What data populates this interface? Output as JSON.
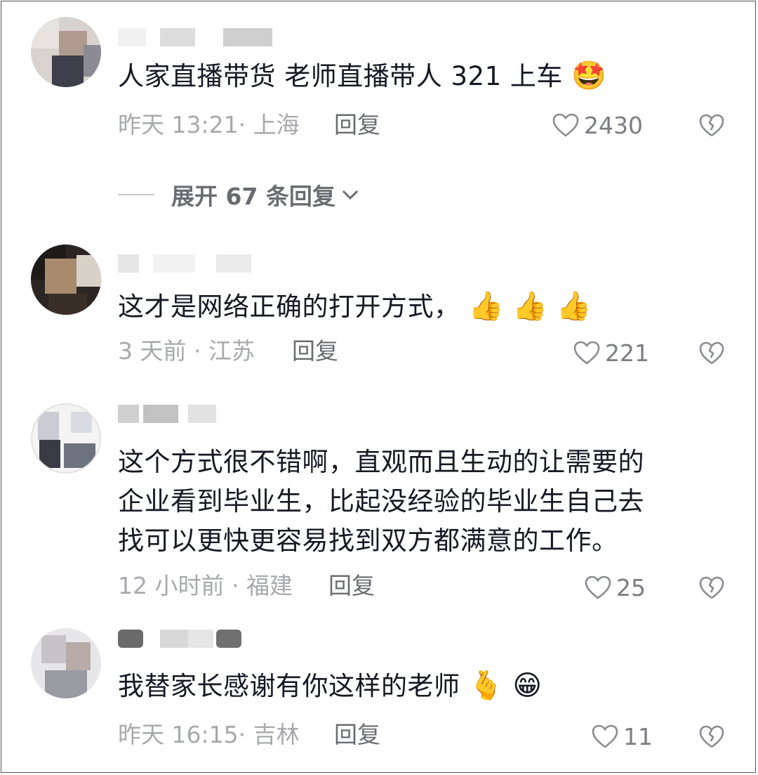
{
  "comments": [
    {
      "text": "人家直播带货 老师直播带人 321 上车",
      "emojis": [
        "🤩"
      ],
      "time_location": "昨天 13:21· 上海",
      "reply_label": "回复",
      "likes": "2430",
      "expand_label": "展开 67 条回复"
    },
    {
      "text": "这才是网络正确的打开方式，",
      "emojis": [
        "👍",
        "👍",
        "👍"
      ],
      "time_location": "3 天前 · 江苏",
      "reply_label": "回复",
      "likes": "221"
    },
    {
      "text_lines": [
        "这个方式很不错啊，直观而且生动的让需要的",
        "企业看到毕业生，比起没经验的毕业生自己去",
        "找可以更快更容易找到双方都满意的工作。"
      ],
      "time_location": "12 小时前 · 福建",
      "reply_label": "回复",
      "likes": "25"
    },
    {
      "text": "我替家长感谢有你这样的老师",
      "emojis": [
        "🫰",
        "😁"
      ],
      "time_location": "昨天 16:15· 吉林",
      "reply_label": "回复",
      "likes": "11"
    }
  ],
  "colors": {
    "text": "#161823",
    "meta": "#a8a9ad",
    "action": "#6b6c72",
    "heart_outline": "#8a8b90"
  }
}
